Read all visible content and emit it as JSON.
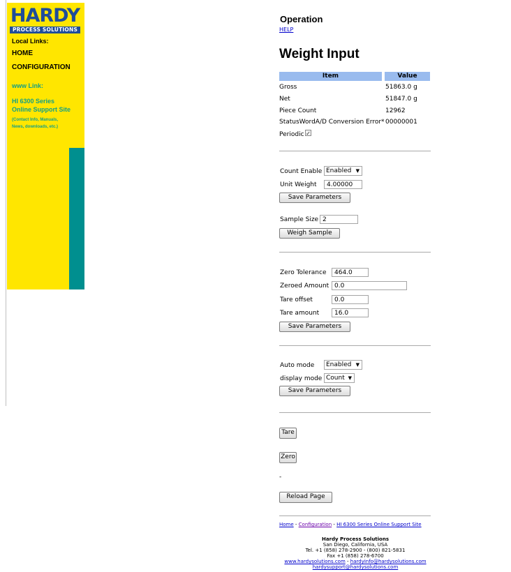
{
  "sidebar": {
    "logo_text": "HARDY",
    "logo_sub": "PROCESS SOLUTIONS",
    "local_links_label": "Local Links:",
    "home_label": "HOME",
    "config_label": "CONFIGURATION",
    "www_label": "www Link:",
    "support_line1": "HI 6300 Series",
    "support_line2": "Online Support Site",
    "support_note1": "(Contact Info, Manuals,",
    "support_note2": "News, downloads, etc.)"
  },
  "header": {
    "section": "Operation",
    "help": "HELP",
    "title": "Weight Input"
  },
  "table": {
    "col_item": "Item",
    "col_value": "Value",
    "rows": [
      {
        "item": "Gross",
        "value": "51863.0 g"
      },
      {
        "item": "Net",
        "value": "51847.0 g"
      },
      {
        "item": "Piece Count",
        "value": "12962"
      },
      {
        "item": "StatusWordA/D Conversion Error*",
        "value": "00000001"
      }
    ]
  },
  "periodic": {
    "label": "Periodic",
    "checked": "✓"
  },
  "count_section": {
    "count_enable_label": "Count Enable",
    "count_enable_value": "Enabled",
    "unit_weight_label": "Unit Weight",
    "unit_weight_value": "4.00000",
    "save_label": "Save Parameters",
    "sample_size_label": "Sample Size",
    "sample_size_value": "2",
    "weigh_sample_label": "Weigh Sample"
  },
  "zero_section": {
    "zero_tolerance_label": "Zero Tolerance",
    "zero_tolerance_value": "464.0",
    "zeroed_amount_label": "Zeroed Amount",
    "zeroed_amount_value": "0.0",
    "tare_offset_label": "Tare offset",
    "tare_offset_value": "0.0",
    "tare_amount_label": "Tare amount",
    "tare_amount_value": "16.0",
    "save_label": "Save Parameters"
  },
  "mode_section": {
    "auto_mode_label": "Auto mode",
    "auto_mode_value": "Enabled",
    "display_mode_label": "display mode",
    "display_mode_value": "Count",
    "save_label": "Save Parameters"
  },
  "actions": {
    "tare": "Tare",
    "zero": "Zero",
    "dash": "-",
    "reload": "Reload Page"
  },
  "footer": {
    "home": "Home",
    "sep1": " - ",
    "configuration": "Configuration",
    "sep2": " - ",
    "support": "HI 6300 Series Online Support Site",
    "company": "Hardy Process Solutions",
    "city": "San Diego, California, USA",
    "tel": "Tel. +1 (858) 278-2900 - (800) 821-5831",
    "fax": "Fax +1 (858) 278-6700",
    "web": "www.hardysolutions.com",
    "sep3": " - ",
    "info_email": "hardyinfo@hardysolutions.com",
    "support_email": "hardysupport@hardysolutions.com"
  },
  "colors": {
    "sidebar_bg": "#ffe600",
    "sidebar_accent": "#008f8f",
    "logo_blue": "#1f4d9a",
    "table_header": "#99bbee",
    "link": "#0000cc"
  }
}
